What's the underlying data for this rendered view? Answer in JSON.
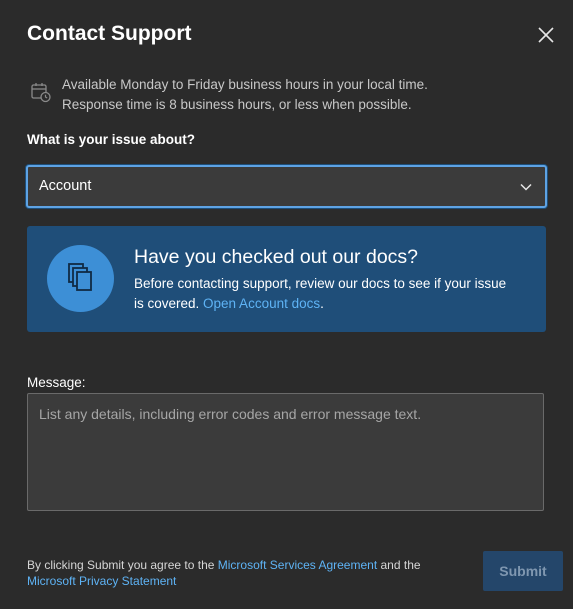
{
  "dialog": {
    "title": "Contact Support",
    "close_icon": "close-icon"
  },
  "info": {
    "icon": "calendar-clock-icon",
    "line1": "Available Monday to Friday business hours in your local time.",
    "line2": "Response time is 8 business hours, or less when possible."
  },
  "issue": {
    "label": "What is your issue about?",
    "selected": "Account",
    "chevron_icon": "chevron-down-icon"
  },
  "docs": {
    "icon": "documents-icon",
    "heading": "Have you checked out our docs?",
    "body_prefix": "Before contacting support, review our docs to see if your issue is covered. ",
    "link": "Open Account docs",
    "body_suffix": "."
  },
  "message": {
    "label": "Message:",
    "placeholder": "List any details, including error codes and error message text."
  },
  "footer": {
    "prefix": "By clicking Submit you agree to the ",
    "services_link": "Microsoft Services Agreement",
    "middle": " and the ",
    "privacy_link": "Microsoft Privacy Statement"
  },
  "submit": {
    "label": "Submit"
  },
  "colors": {
    "background": "#2b2b2b",
    "accent": "#5ea3e4",
    "docs_card": "#1f4e79",
    "link": "#5eb3f5",
    "submit_disabled": "#24466a"
  }
}
